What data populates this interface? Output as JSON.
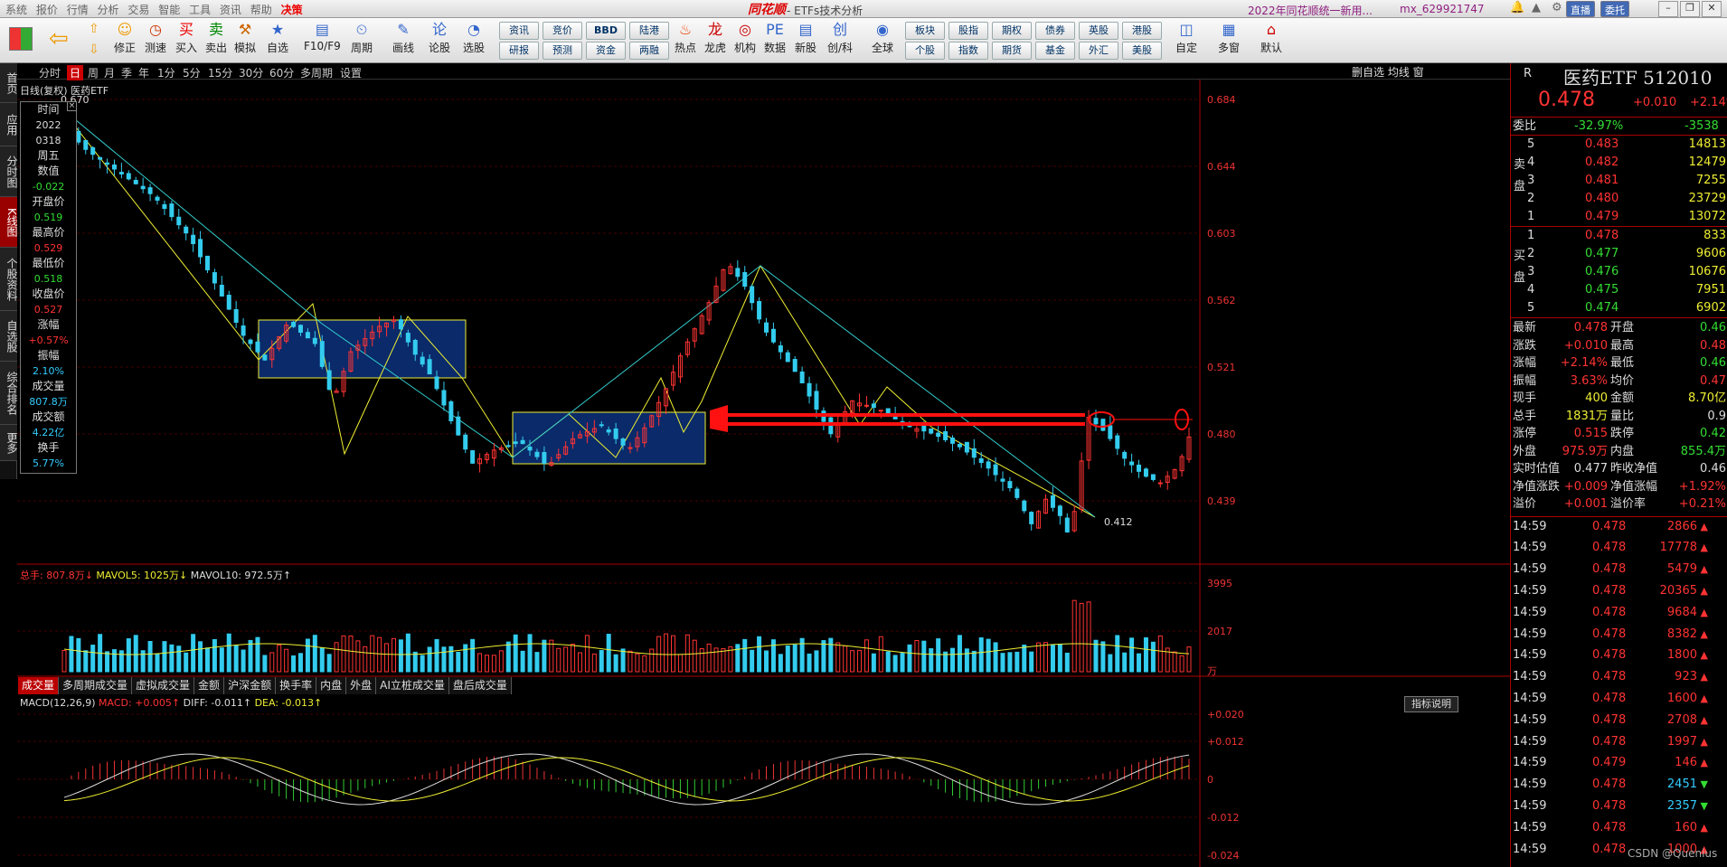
{
  "menubar": {
    "items": [
      "系统",
      "报价",
      "行情",
      "分析",
      "交易",
      "智能",
      "工具",
      "资讯",
      "帮助",
      "决策"
    ],
    "brand": "同花顺",
    "window_title": "- ETFs技术分析",
    "news": "2022年同花顺统一新用...",
    "user": "mx_629921747",
    "direct_label": "直播",
    "entrust_label": "委托"
  },
  "toolbar": {
    "buttons": [
      "修正",
      "测速",
      "买入",
      "卖出",
      "模拟",
      "自选",
      "F10/F9",
      "周期",
      "画线",
      "论股",
      "选股",
      "热点",
      "龙虎",
      "机构",
      "数据",
      "新股",
      "创/科",
      "全球",
      "自定",
      "多窗",
      "默认"
    ],
    "grid": [
      [
        "资讯",
        "竞价",
        "BBD",
        "陆港"
      ],
      [
        "研报",
        "预测",
        "资金",
        "两融"
      ],
      [
        "板块",
        "股指",
        "期权",
        "债券",
        "英股",
        "港股"
      ],
      [
        "个股",
        "指数",
        "期货",
        "基金",
        "外汇",
        "美股"
      ]
    ]
  },
  "lefttabs": [
    "首页",
    "应用",
    "分时图",
    "K线图",
    "个股资料",
    "自选股",
    "综合排名",
    "更多"
  ],
  "periods": [
    "分时",
    "日",
    "周",
    "月",
    "季",
    "年",
    "1分",
    "5分",
    "15分",
    "30分",
    "60分",
    "多周期",
    "设置"
  ],
  "chart": {
    "title": "日线(复权)",
    "name": "医药ETF",
    "tools": "删自选 均线 窗",
    "high_label": "0.670",
    "low_label": "0.412",
    "price_axis": [
      "0.684",
      "0.644",
      "0.603",
      "0.562",
      "0.521",
      "0.480",
      "0.439"
    ],
    "vol_axis": [
      "3995",
      "2017",
      "万"
    ],
    "macd_axis": [
      "+0.020",
      "+0.012",
      "0",
      "-0.012",
      "-0.024"
    ]
  },
  "datawin": [
    [
      "时间",
      "2022"
    ],
    [
      "",
      "0318"
    ],
    [
      "周五",
      ""
    ],
    [
      "数值",
      "-0.022"
    ],
    [
      "开盘价",
      "0.519"
    ],
    [
      "最高价",
      "0.529"
    ],
    [
      "最低价",
      "0.518"
    ],
    [
      "收盘价",
      "0.527"
    ],
    [
      "涨幅",
      "+0.57%"
    ],
    [
      "振幅",
      "2.10%"
    ],
    [
      "成交量",
      "807.8万"
    ],
    [
      "成交额",
      "4.22亿"
    ],
    [
      "换手",
      "5.77%"
    ]
  ],
  "volume": {
    "label": "总手: 807.8万↓",
    "ma5": "MAVOL5: 1025万↓",
    "ma10": "MAVOL10: 972.5万↑"
  },
  "voltabs": [
    "成交量",
    "多周期成交量",
    "虚拟成交量",
    "金额",
    "沪深金额",
    "换手率",
    "内盘",
    "外盘",
    "AI立桩成交量",
    "盘后成交量"
  ],
  "macd": {
    "label": "MACD(12,26,9)",
    "macd": "MACD: +0.005↑",
    "diff": "DIFF: -0.011↑",
    "dea": "DEA: -0.013↑",
    "explain": "指标说明"
  },
  "quote": {
    "code": "R",
    "name": "医药ETF 512010",
    "price": "0.478",
    "change": "+0.010",
    "change_pct": "+2.14%",
    "weibi": [
      "委比",
      "-32.97%",
      "-3538"
    ],
    "asks": [
      [
        "5",
        "0.483",
        "14813"
      ],
      [
        "4",
        "0.482",
        "12479"
      ],
      [
        "3",
        "0.481",
        "7255"
      ],
      [
        "2",
        "0.480",
        "23729"
      ],
      [
        "1",
        "0.479",
        "13072"
      ]
    ],
    "bids": [
      [
        "1",
        "0.478",
        "833"
      ],
      [
        "2",
        "0.477",
        "9606"
      ],
      [
        "3",
        "0.476",
        "10676"
      ],
      [
        "4",
        "0.475",
        "7951"
      ],
      [
        "5",
        "0.474",
        "6902"
      ]
    ],
    "ask_label": "卖盘",
    "bid_label": "买盘",
    "stats": [
      [
        "最新",
        "0.478",
        "开盘",
        "0.46"
      ],
      [
        "涨跌",
        "+0.010",
        "最高",
        "0.48"
      ],
      [
        "涨幅",
        "+2.14%",
        "最低",
        "0.46"
      ],
      [
        "振幅",
        "3.63%",
        "均价",
        "0.47"
      ],
      [
        "现手",
        "400",
        "金额",
        "8.70亿"
      ],
      [
        "总手",
        "1831万",
        "量比",
        "0.9"
      ],
      [
        "涨停",
        "0.515",
        "跌停",
        "0.42"
      ],
      [
        "外盘",
        "975.9万",
        "内盘",
        "855.4万"
      ],
      [
        "实时估值",
        "0.477",
        "昨收净值",
        "0.46"
      ],
      [
        "净值涨跌",
        "+0.009",
        "净值涨幅",
        "+1.92%"
      ],
      [
        "溢价",
        "+0.001",
        "溢价率",
        "+0.21%"
      ]
    ],
    "ticks": [
      [
        "14:59",
        "0.478",
        "2866"
      ],
      [
        "14:59",
        "0.478",
        "17778"
      ],
      [
        "14:59",
        "0.478",
        "5479"
      ],
      [
        "14:59",
        "0.478",
        "20365"
      ],
      [
        "14:59",
        "0.478",
        "9684"
      ],
      [
        "14:59",
        "0.478",
        "8382"
      ],
      [
        "14:59",
        "0.478",
        "1800"
      ],
      [
        "14:59",
        "0.478",
        "923"
      ],
      [
        "14:59",
        "0.478",
        "1600"
      ],
      [
        "14:59",
        "0.478",
        "2708"
      ],
      [
        "14:59",
        "0.478",
        "1997"
      ],
      [
        "14:59",
        "0.479",
        "146"
      ],
      [
        "14:59",
        "0.478",
        "2451"
      ],
      [
        "14:59",
        "0.478",
        "2357"
      ],
      [
        "14:59",
        "0.478",
        "160"
      ],
      [
        "14:59",
        "0.478",
        "1000"
      ]
    ]
  },
  "watermark": "CSDN @Quenius",
  "colors": {
    "up": "#ff3333",
    "down": "#33ccee",
    "panel_line": "#aa0000",
    "ma": "#eeee33"
  }
}
